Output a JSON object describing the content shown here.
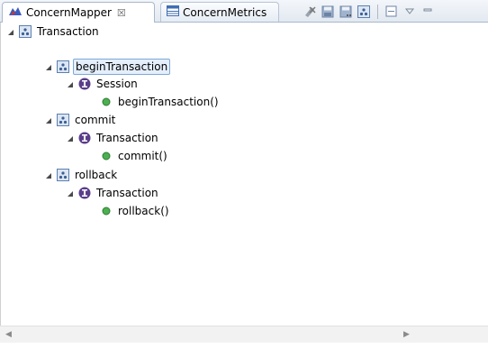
{
  "tabs": [
    {
      "label": "ConcernMapper",
      "close": "☒"
    },
    {
      "label": "ConcernMetrics"
    }
  ],
  "toolbar": {
    "icons": [
      "remove-icon",
      "save-icon",
      "save-as-icon",
      "new-concern-icon",
      "collapse-all-icon",
      "view-menu-icon",
      "minimize-icon"
    ]
  },
  "tree": {
    "root": {
      "label": "Transaction"
    },
    "concerns": [
      {
        "label": "beginTransaction",
        "type": {
          "label": "Session"
        },
        "member": {
          "label": "beginTransaction()"
        }
      },
      {
        "label": "commit",
        "type": {
          "label": "Transaction"
        },
        "member": {
          "label": "commit()"
        }
      },
      {
        "label": "rollback",
        "type": {
          "label": "Transaction"
        },
        "member": {
          "label": "rollback()"
        }
      }
    ]
  },
  "colors": {
    "accent": "#7fa7d8",
    "selection_bg": "#e4effb",
    "interface_icon": "#5a3d8a",
    "method_icon": "#4caf50"
  }
}
